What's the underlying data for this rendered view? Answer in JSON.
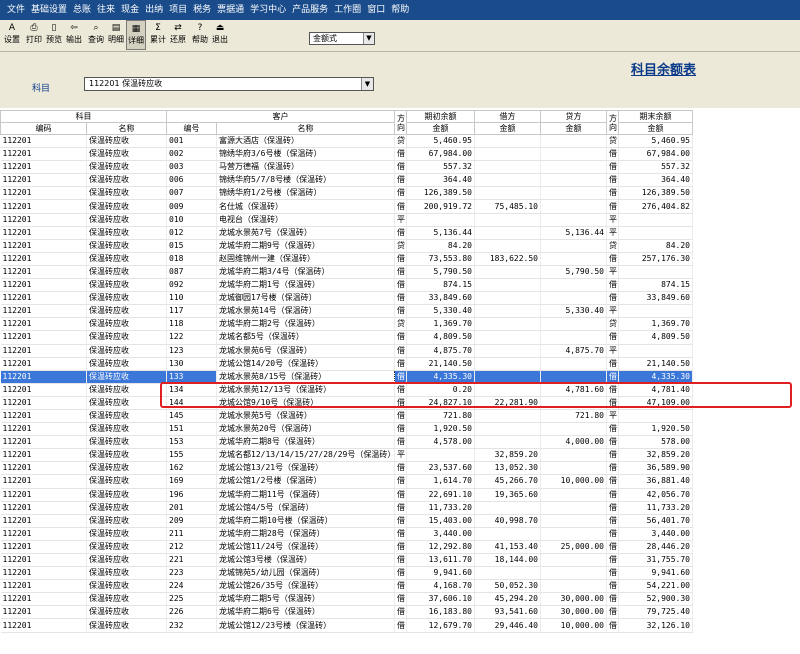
{
  "menu": [
    "文件",
    "基础设置",
    "总账",
    "往来",
    "现金",
    "出纳",
    "项目",
    "税务",
    "票据通",
    "学习中心",
    "产品服务",
    "工作圈",
    "窗口",
    "帮助"
  ],
  "toolbar": [
    {
      "label": "设置",
      "icon": "settings-icon",
      "glyph": "A"
    },
    {
      "label": "打印",
      "icon": "print-icon",
      "glyph": "⎙"
    },
    {
      "label": "预览",
      "icon": "preview-icon",
      "glyph": "▯"
    },
    {
      "label": "输出",
      "icon": "export-icon",
      "glyph": "⇦"
    },
    {
      "label": "查询",
      "icon": "binoculars-icon",
      "glyph": "⌕"
    },
    {
      "label": "明细",
      "icon": "detail-icon",
      "glyph": "▤"
    },
    {
      "label": "详细",
      "icon": "list-icon",
      "glyph": "▦"
    },
    {
      "label": "累计",
      "icon": "sigma-icon",
      "glyph": "Σ"
    },
    {
      "label": "还原",
      "icon": "restore-icon",
      "glyph": "⇄"
    },
    {
      "label": "帮助",
      "icon": "help-icon",
      "glyph": "?"
    },
    {
      "label": "退出",
      "icon": "exit-icon",
      "glyph": "⏏"
    }
  ],
  "format_select": "金额式",
  "report_title": "科目余额表",
  "subject_label": "科目",
  "subject_value": "112201 保温砖应收",
  "table": {
    "group_headers": {
      "subject": "科目",
      "customer": "客户",
      "direction1": "方向",
      "opening": "期初余额",
      "debit": "借方",
      "credit": "贷方",
      "direction2": "方向",
      "closing": "期末余额"
    },
    "sub_headers": {
      "code": "编码",
      "name": "名称",
      "cust_no": "编号",
      "cust_name": "名称",
      "amount1": "金额",
      "amount2": "金额",
      "amount3": "金额",
      "amount4": "金额"
    },
    "rows": [
      [
        "112201",
        "保温砖应收",
        "001",
        "富源大酒店（保温砖）",
        "贷",
        "5,460.95",
        "",
        "",
        "贷",
        "5,460.95"
      ],
      [
        "112201",
        "保温砖应收",
        "002",
        "锦绣华府3/6号楼（保温砖）",
        "借",
        "67,984.00",
        "",
        "",
        "借",
        "67,984.00"
      ],
      [
        "112201",
        "保温砖应收",
        "003",
        "马营万德福（保温砖）",
        "借",
        "557.32",
        "",
        "",
        "借",
        "557.32"
      ],
      [
        "112201",
        "保温砖应收",
        "006",
        "锦绣华府5/7/8号楼（保温砖）",
        "借",
        "364.40",
        "",
        "",
        "借",
        "364.40"
      ],
      [
        "112201",
        "保温砖应收",
        "007",
        "锦绣华府1/2号楼（保温砖）",
        "借",
        "126,389.50",
        "",
        "",
        "借",
        "126,389.50"
      ],
      [
        "112201",
        "保温砖应收",
        "009",
        "名仕城（保温砖）",
        "借",
        "200,919.72",
        "75,485.10",
        "",
        "借",
        "276,404.82"
      ],
      [
        "112201",
        "保温砖应收",
        "010",
        "电视台（保温砖）",
        "平",
        "",
        "",
        "",
        "平",
        ""
      ],
      [
        "112201",
        "保温砖应收",
        "012",
        "龙城水景苑7号（保温砖）",
        "借",
        "5,136.44",
        "",
        "5,136.44",
        "平",
        ""
      ],
      [
        "112201",
        "保温砖应收",
        "015",
        "龙城华府二期9号（保温砖）",
        "贷",
        "84.20",
        "",
        "",
        "贷",
        "84.20"
      ],
      [
        "112201",
        "保温砖应收",
        "018",
        "赵固维锦州一建（保温砖）",
        "借",
        "73,553.80",
        "183,622.50",
        "",
        "借",
        "257,176.30"
      ],
      [
        "112201",
        "保温砖应收",
        "087",
        "龙城华府二期3/4号（保温砖）",
        "借",
        "5,790.50",
        "",
        "5,790.50",
        "平",
        ""
      ],
      [
        "112201",
        "保温砖应收",
        "092",
        "龙城华府二期1号（保温砖）",
        "借",
        "874.15",
        "",
        "",
        "借",
        "874.15"
      ],
      [
        "112201",
        "保温砖应收",
        "110",
        "龙城御园17号楼（保温砖）",
        "借",
        "33,849.60",
        "",
        "",
        "借",
        "33,849.60"
      ],
      [
        "112201",
        "保温砖应收",
        "117",
        "龙城水景苑14号（保温砖）",
        "借",
        "5,330.40",
        "",
        "5,330.40",
        "平",
        ""
      ],
      [
        "112201",
        "保温砖应收",
        "118",
        "龙城华府二期2号（保温砖）",
        "贷",
        "1,369.70",
        "",
        "",
        "贷",
        "1,369.70"
      ],
      [
        "112201",
        "保温砖应收",
        "122",
        "龙城名都5号（保温砖）",
        "借",
        "4,809.50",
        "",
        "",
        "借",
        "4,809.50"
      ],
      [
        "112201",
        "保温砖应收",
        "123",
        "龙城水景苑6号（保温砖）",
        "借",
        "4,875.70",
        "",
        "4,875.70",
        "平",
        ""
      ],
      [
        "112201",
        "保温砖应收",
        "130",
        "龙城公馆14/20号（保温砖）",
        "借",
        "21,140.50",
        "",
        "",
        "借",
        "21,140.50"
      ],
      [
        "112201",
        "保温砖应收",
        "133",
        "龙城水景苑8/15号（保温砖）",
        "借",
        "4,335.30",
        "",
        "",
        "借",
        "4,335.30"
      ],
      [
        "112201",
        "保温砖应收",
        "134",
        "龙城水景苑12/13号（保温砖）",
        "借",
        "0.20",
        "",
        "4,781.60",
        "借",
        "4,781.40"
      ],
      [
        "112201",
        "保温砖应收",
        "144",
        "龙城公馆9/10号（保温砖）",
        "借",
        "24,827.10",
        "22,281.90",
        "",
        "借",
        "47,109.00"
      ],
      [
        "112201",
        "保温砖应收",
        "145",
        "龙城水景苑5号（保温砖）",
        "借",
        "721.80",
        "",
        "721.80",
        "平",
        ""
      ],
      [
        "112201",
        "保温砖应收",
        "151",
        "龙城水景苑20号（保温砖）",
        "借",
        "1,920.50",
        "",
        "",
        "借",
        "1,920.50"
      ],
      [
        "112201",
        "保温砖应收",
        "153",
        "龙城华府二期8号（保温砖）",
        "借",
        "4,578.00",
        "",
        "4,000.00",
        "借",
        "578.00"
      ],
      [
        "112201",
        "保温砖应收",
        "155",
        "龙城名都12/13/14/15/27/28/29号（保温砖）",
        "平",
        "",
        "32,859.20",
        "",
        "借",
        "32,859.20"
      ],
      [
        "112201",
        "保温砖应收",
        "162",
        "龙城公馆13/21号（保温砖）",
        "借",
        "23,537.60",
        "13,052.30",
        "",
        "借",
        "36,589.90"
      ],
      [
        "112201",
        "保温砖应收",
        "169",
        "龙城公馆1/2号楼（保温砖）",
        "借",
        "1,614.70",
        "45,266.70",
        "10,000.00",
        "借",
        "36,881.40"
      ],
      [
        "112201",
        "保温砖应收",
        "196",
        "龙城华府二期11号（保温砖）",
        "借",
        "22,691.10",
        "19,365.60",
        "",
        "借",
        "42,056.70"
      ],
      [
        "112201",
        "保温砖应收",
        "201",
        "龙城公馆4/5号（保温砖）",
        "借",
        "11,733.20",
        "",
        "",
        "借",
        "11,733.20"
      ],
      [
        "112201",
        "保温砖应收",
        "209",
        "龙城华府二期10号楼（保温砖）",
        "借",
        "15,403.00",
        "40,998.70",
        "",
        "借",
        "56,401.70"
      ],
      [
        "112201",
        "保温砖应收",
        "211",
        "龙城华府二期28号（保温砖）",
        "借",
        "3,440.00",
        "",
        "",
        "借",
        "3,440.00"
      ],
      [
        "112201",
        "保温砖应收",
        "212",
        "龙城公馆11/24号（保温砖）",
        "借",
        "12,292.80",
        "41,153.40",
        "25,000.00",
        "借",
        "28,446.20"
      ],
      [
        "112201",
        "保温砖应收",
        "221",
        "龙城公馆3号楼（保温砖）",
        "借",
        "13,611.70",
        "18,144.00",
        "",
        "借",
        "31,755.70"
      ],
      [
        "112201",
        "保温砖应收",
        "223",
        "龙城锦苑5/幼儿园（保温砖）",
        "借",
        "9,941.60",
        "",
        "",
        "借",
        "9,941.60"
      ],
      [
        "112201",
        "保温砖应收",
        "224",
        "龙城公馆26/35号（保温砖）",
        "借",
        "4,168.70",
        "50,052.30",
        "",
        "借",
        "54,221.00"
      ],
      [
        "112201",
        "保温砖应收",
        "225",
        "龙城华府二期5号（保温砖）",
        "借",
        "37,606.10",
        "45,294.20",
        "30,000.00",
        "借",
        "52,900.30"
      ],
      [
        "112201",
        "保温砖应收",
        "226",
        "龙城华府二期6号（保温砖）",
        "借",
        "16,183.80",
        "93,541.60",
        "30,000.00",
        "借",
        "79,725.40"
      ],
      [
        "112201",
        "保温砖应收",
        "232",
        "龙城公馆12/23号楼（保温砖）",
        "借",
        "12,679.70",
        "29,446.40",
        "10,000.00",
        "借",
        "32,126.10"
      ]
    ],
    "selected_row": 18
  }
}
